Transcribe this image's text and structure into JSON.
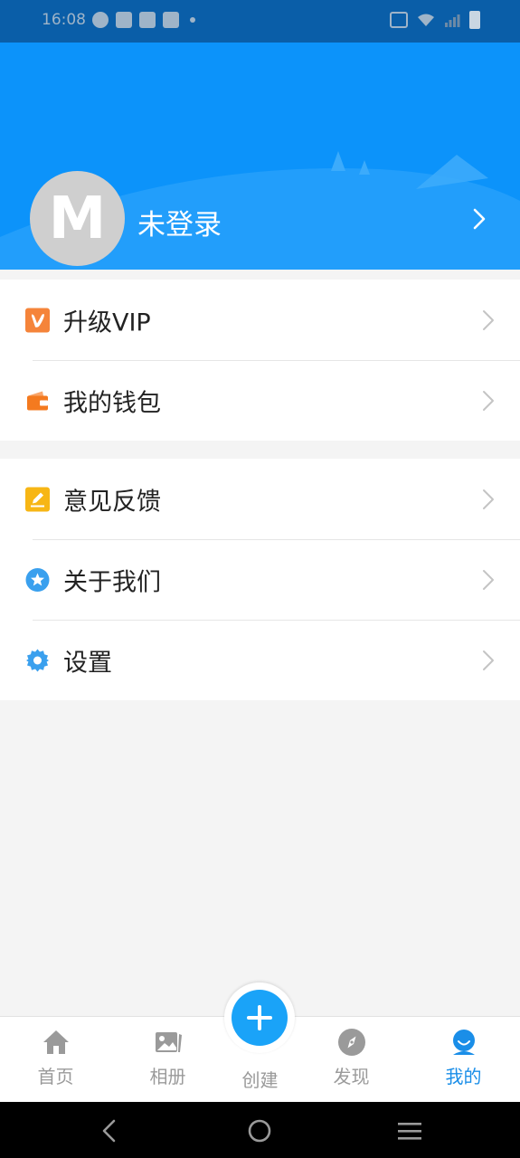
{
  "status_bar": {
    "time": "16:08",
    "icons": [
      "activity-icon",
      "mail-icon",
      "mail-icon",
      "mail-icon",
      "dot-icon",
      "vibrate-icon",
      "wifi-icon",
      "signal-icon",
      "battery-icon"
    ]
  },
  "header": {
    "avatar_letter": "M",
    "login_text": "未登录",
    "background_color": "#0c93fa"
  },
  "menu": {
    "group1": [
      {
        "label": "升级VIP",
        "icon": "vip-icon",
        "icon_color": "#f5843a"
      },
      {
        "label": "我的钱包",
        "icon": "wallet-icon",
        "icon_color": "#f47a1f"
      }
    ],
    "group2": [
      {
        "label": "意见反馈",
        "icon": "feedback-icon",
        "icon_color": "#f7b615"
      },
      {
        "label": "关于我们",
        "icon": "star-badge-icon",
        "icon_color": "#3aa0ee"
      },
      {
        "label": "设置",
        "icon": "gear-icon",
        "icon_color": "#3aa0ee"
      }
    ]
  },
  "tabbar": {
    "home": "首页",
    "album": "相册",
    "create": "创建",
    "discover": "发现",
    "mine": "我的",
    "active": "mine",
    "active_color": "#1a8ee8",
    "inactive_color": "#9a9a9a"
  }
}
